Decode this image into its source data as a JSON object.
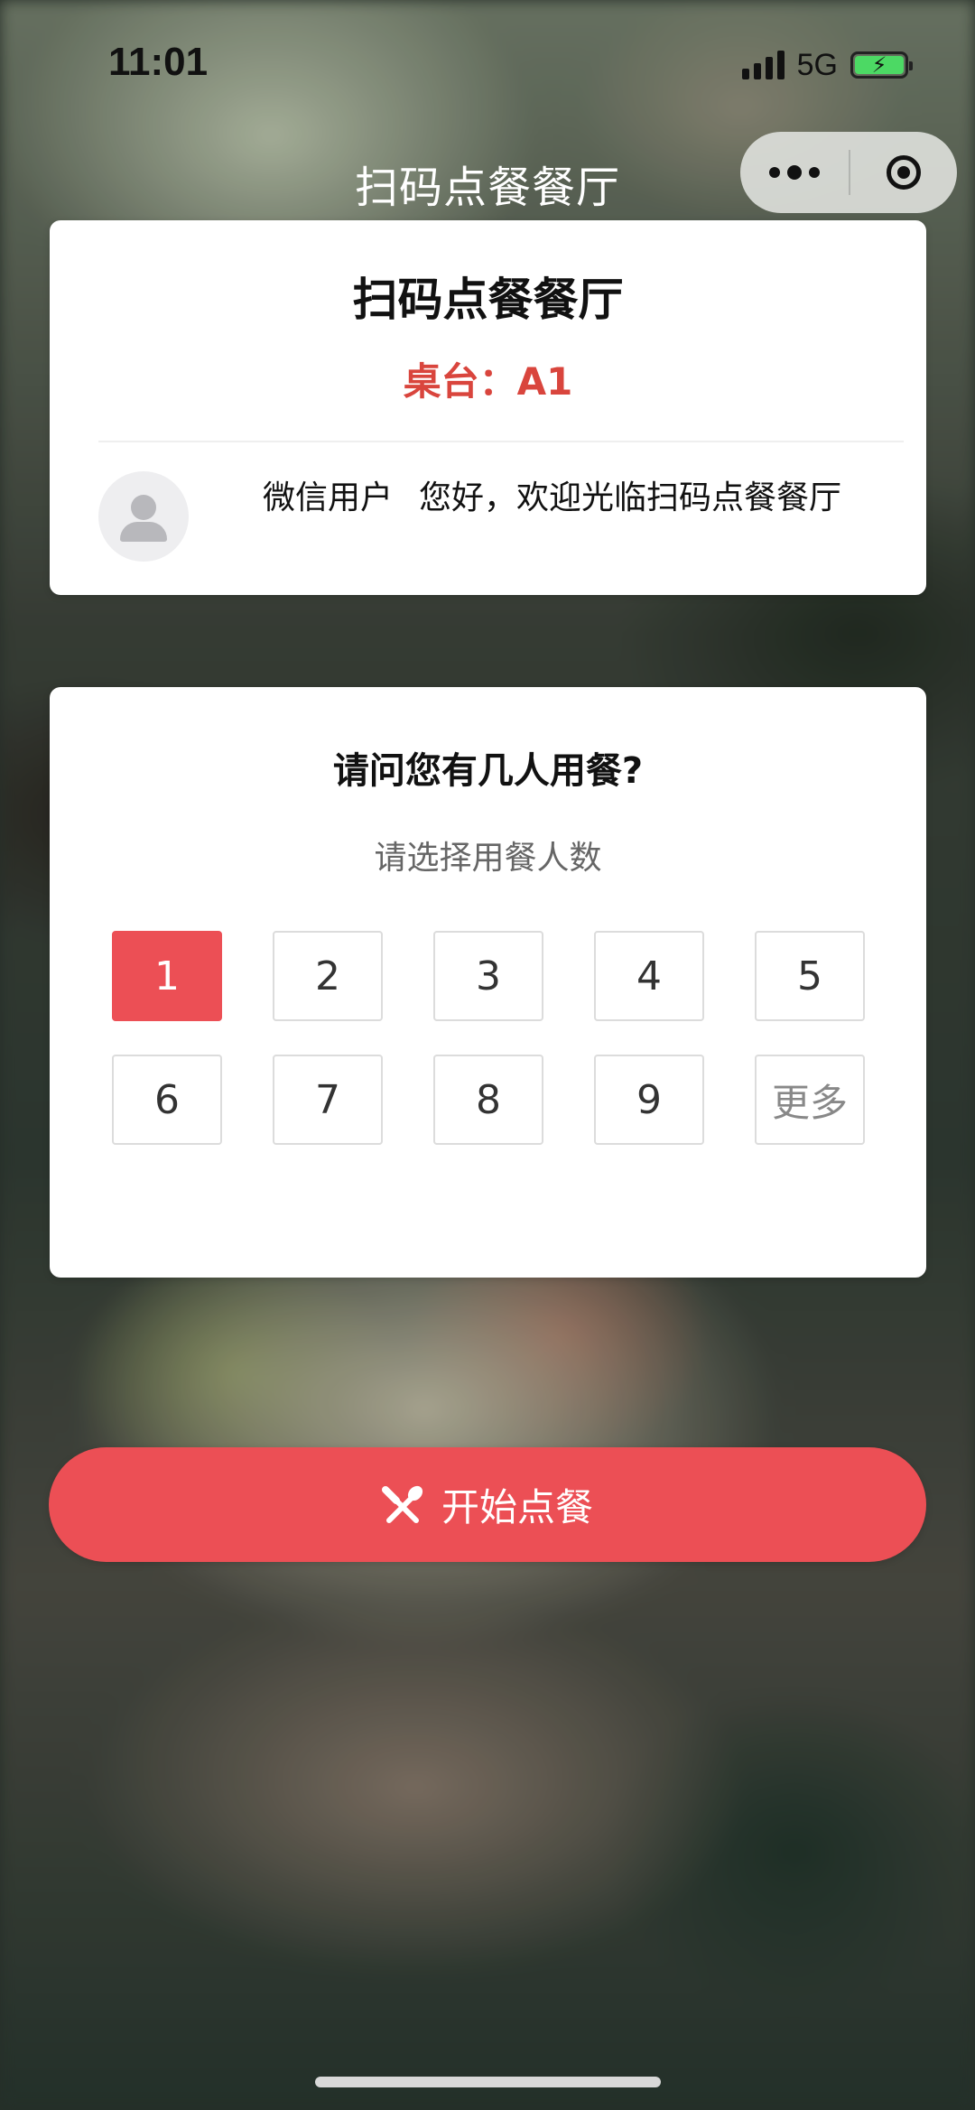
{
  "status_bar": {
    "time": "11:01",
    "network": "5G",
    "battery_charging": true
  },
  "nav": {
    "title": "扫码点餐餐厅",
    "more_icon": "more-dots-icon",
    "close_icon": "target-close-icon"
  },
  "restaurant": {
    "name": "扫码点餐餐厅",
    "table_label": "桌台：A1",
    "user_name": "微信用户",
    "welcome": "您好，欢迎光临扫码点餐餐厅"
  },
  "diners": {
    "question": "请问您有几人用餐?",
    "hint": "请选择用餐人数",
    "options": [
      "1",
      "2",
      "3",
      "4",
      "5",
      "6",
      "7",
      "8",
      "9",
      "更多"
    ],
    "selected": "1"
  },
  "start": {
    "label": "开始点餐",
    "icon": "utensils-icon"
  },
  "colors": {
    "accent": "#ec4f55",
    "table_text": "#d9453d"
  }
}
